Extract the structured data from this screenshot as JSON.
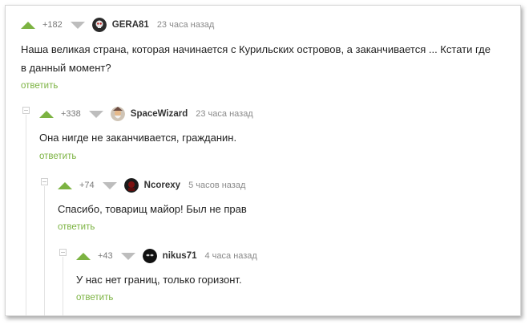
{
  "comments": [
    {
      "rating": "+182",
      "username": "GERA81",
      "time": "23 часа назад",
      "avatar_icon": "dark-skull-avatar",
      "text_line1": "Наша великая страна, которая начинается с Курильских островов, а заканчивается ... Кстати где",
      "text_line2": "в данный момент?",
      "reply": "ответить"
    },
    {
      "rating": "+338",
      "username": "SpaceWizard",
      "time": "23 часа назад",
      "avatar_icon": "wizard-avatar",
      "text_line1": "Она нигде не заканчивается, гражданин.",
      "reply": "ответить"
    },
    {
      "rating": "+74",
      "username": "Ncorexy",
      "time": "5 часов назад",
      "avatar_icon": "dark-red-avatar",
      "text_line1": "Спасибо, товарищ майор! Был не прав",
      "reply": "ответить"
    },
    {
      "rating": "+43",
      "username": "nikus71",
      "time": "4 часа назад",
      "avatar_icon": "black-mask-avatar",
      "text_line1": "У нас нет границ, только горизонт.",
      "reply": "ответить"
    }
  ],
  "colors": {
    "accent_green": "#7cb342",
    "vote_down_grey": "#bdbdbd",
    "meta_grey": "#8a8a8a"
  }
}
